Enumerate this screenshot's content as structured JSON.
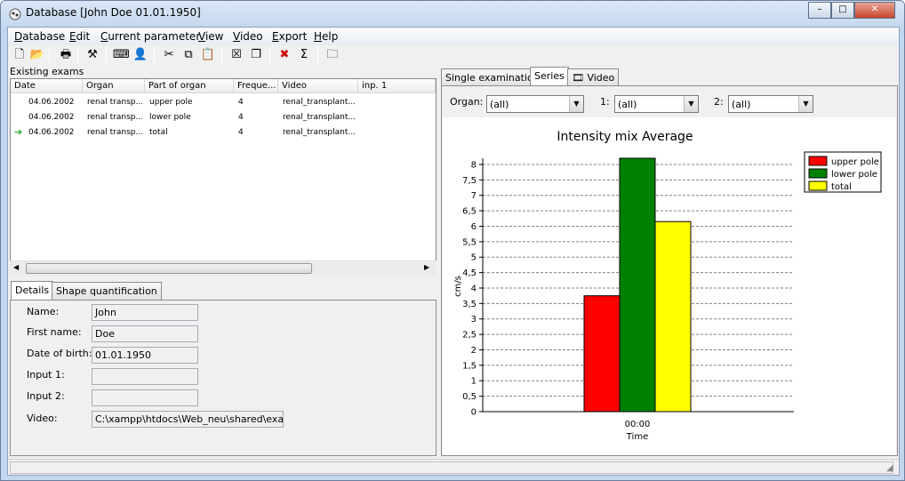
{
  "window": {
    "title": "Database [John Doe 01.01.1950]",
    "minimize": "–",
    "maximize": "□",
    "close": "✕"
  },
  "menu": [
    {
      "key": "D",
      "rest": "atabase"
    },
    {
      "key": "E",
      "rest": "dit"
    },
    {
      "key": "C",
      "rest": "urrent parameter"
    },
    {
      "key": "V",
      "rest": "iew"
    },
    {
      "key": "V",
      "rest": "ideo"
    },
    {
      "key": "E",
      "rest": "xport"
    },
    {
      "key": "H",
      "rest": "elp"
    }
  ],
  "toolbar_icons": [
    "new-file-icon",
    "open-folder-icon",
    "print-icon",
    "tools-icon",
    "keyboard-icon",
    "user-icon",
    "cut-icon",
    "copy-icon",
    "paste-icon",
    "delete-box-icon",
    "window-icon",
    "delete-x-icon",
    "sum-icon",
    "folder-icon"
  ],
  "toolbar_glyphs": [
    "🗋",
    "📂",
    "🖶",
    "⚒",
    "⌨",
    "👤",
    "✂",
    "⧉",
    "📋",
    "☒",
    "❐",
    "✖",
    "Σ",
    "🗀"
  ],
  "exams": {
    "label": "Existing exams",
    "columns": [
      "Date",
      "Organ",
      "Part of organ",
      "Freque...",
      "Video",
      "inp. 1"
    ],
    "rows": [
      {
        "date": "04.06.2002",
        "organ": "renal transp...",
        "part": "upper pole",
        "freq": "4",
        "video": "renal_transplant...",
        "marker": ""
      },
      {
        "date": "04.06.2002",
        "organ": "renal transp...",
        "part": "lower pole",
        "freq": "4",
        "video": "renal_transplant...",
        "marker": ""
      },
      {
        "date": "04.06.2002",
        "organ": "renal transp...",
        "part": "total",
        "freq": "4",
        "video": "renal_transplant...",
        "marker": "➔"
      }
    ]
  },
  "details_tabs": [
    "Details",
    "Shape quantification"
  ],
  "details": {
    "name_label": "Name:",
    "name_value": "John",
    "first_label": "First name:",
    "first_value": "Doe",
    "dob_label": "Date of birth:",
    "dob_value": "01.01.1950",
    "input1_label": "Input 1:",
    "input1_value": "",
    "input2_label": "Input 2:",
    "input2_value": "",
    "video_label": "Video:",
    "video_value": "C:\\xampp\\htdocs\\Web_neu\\shared\\exampl"
  },
  "right_tabs": [
    "Single examination",
    "Series",
    "Video"
  ],
  "filters": {
    "organ_label": "Organ:",
    "organ_value": "(all)",
    "f1_label": "1:",
    "f1_value": "(all)",
    "f2_label": "2:",
    "f2_value": "(all)"
  },
  "chart_data": {
    "type": "bar",
    "title": "Intensity mix Average",
    "categories": [
      "00:00"
    ],
    "xlabel": "Time",
    "ylabel": "cm/s",
    "ylim": [
      0,
      8.2
    ],
    "yticks": [
      "0",
      "0,5",
      "1",
      "1,5",
      "2",
      "2,5",
      "3",
      "3,5",
      "4",
      "4,5",
      "5",
      "5,5",
      "6",
      "6,5",
      "7",
      "7,5",
      "8"
    ],
    "grid": true,
    "legend_position": "top-right",
    "series": [
      {
        "name": "upper pole",
        "values": [
          3.75
        ],
        "color": "#ff0000"
      },
      {
        "name": "lower pole",
        "values": [
          8.2
        ],
        "color": "#008000"
      },
      {
        "name": "total",
        "values": [
          6.15
        ],
        "color": "#ffff00"
      }
    ]
  },
  "colors": {
    "title_bar": "#c5d8ef",
    "client": "#f0f0f0",
    "arrow": "#28a428"
  }
}
